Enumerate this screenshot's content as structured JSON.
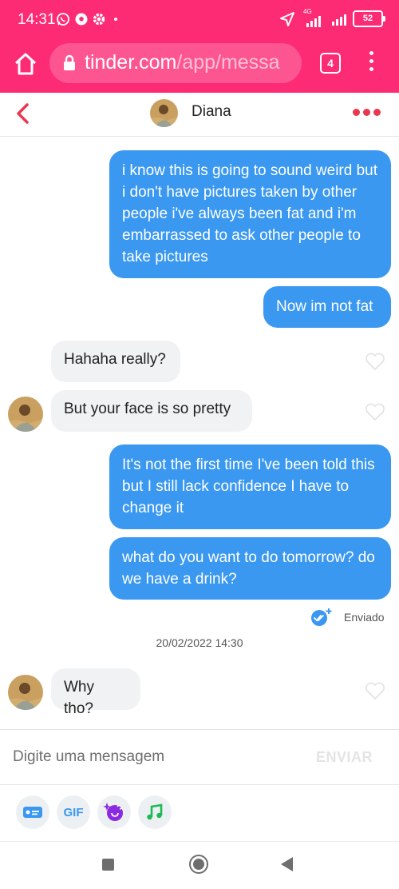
{
  "status_bar": {
    "time": "14:31",
    "network_label": "4G",
    "battery": "52"
  },
  "browser": {
    "url_host": "tinder.com",
    "url_path": "/app/messa",
    "tab_count": "4"
  },
  "chat": {
    "contact_name": "Diana"
  },
  "messages": [
    {
      "from": "me",
      "text": "i know this is going to sound weird but i don't have pictures taken by other people i've always been fat and i'm embarrassed to ask other people to take pictures"
    },
    {
      "from": "me",
      "text": "Now im not fat"
    },
    {
      "from": "them",
      "text": "Hahaha really?"
    },
    {
      "from": "them",
      "text": "But your face is so pretty"
    },
    {
      "from": "me",
      "text": "It's not the first time I've been told this but I still lack confidence I have to change it"
    },
    {
      "from": "me",
      "text": "what do you want to do tomorrow? do we have a drink?"
    },
    {
      "from": "them",
      "text": "Why tho?"
    }
  ],
  "sent_status": "Enviado",
  "date_separator": "20/02/2022 14:30",
  "composer": {
    "placeholder": "Digite uma mensagem",
    "send_label": "ENVIAR"
  },
  "tools": {
    "gif_label": "GIF"
  },
  "colors": {
    "brand": "#fd2b73",
    "outgoing_bubble": "#3a98f0",
    "incoming_bubble": "#f0f2f4",
    "accent_red": "#e8384f"
  }
}
